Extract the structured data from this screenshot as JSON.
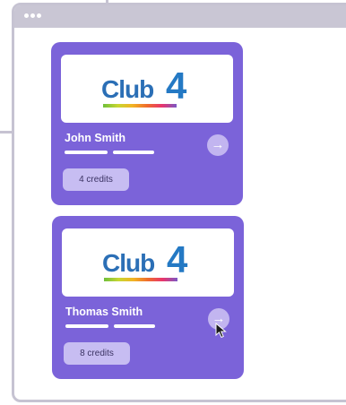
{
  "logo": {
    "word": "Club",
    "number": "4"
  },
  "cards": [
    {
      "name": "John Smith",
      "credits": "4 credits",
      "arrow": "→"
    },
    {
      "name": "Thomas Smith",
      "credits": "8 credits",
      "arrow": "→"
    }
  ],
  "colors": {
    "card": "#7b63d9",
    "window_border": "#c6c3d2",
    "credits_pill": "#c7bdf2"
  },
  "icons": [
    "window-dot-icon",
    "arrow-right-icon",
    "mouse-cursor-icon"
  ]
}
